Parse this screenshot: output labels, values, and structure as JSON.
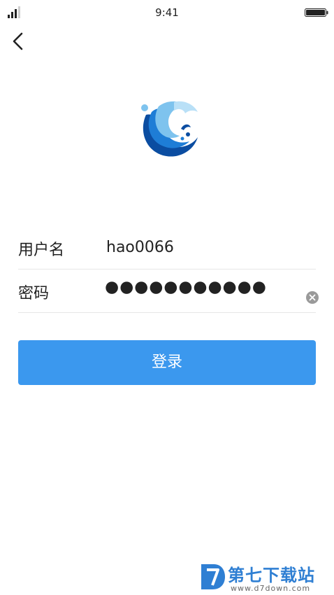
{
  "status_bar": {
    "time": "9:41",
    "signal_icon": "signal-bars-icon",
    "battery_icon": "battery-full-icon"
  },
  "nav": {
    "back_icon": "chevron-left-icon"
  },
  "logo": {
    "icon": "wave-logo-icon",
    "colors": {
      "dark": "#0b4da1",
      "mid": "#1e7dd6",
      "light": "#7ec3ee"
    }
  },
  "form": {
    "username": {
      "label": "用户名",
      "value": "hao0066"
    },
    "password": {
      "label": "密码",
      "masked_value": "●●●●●●●●●●●",
      "clear_icon": "clear-circle-icon"
    },
    "login_button": {
      "label": "登录",
      "color": "#3b98ee"
    }
  },
  "watermark": {
    "title": "第七下载站",
    "url": "www.d7down.com",
    "color": "#2f7fd3"
  }
}
